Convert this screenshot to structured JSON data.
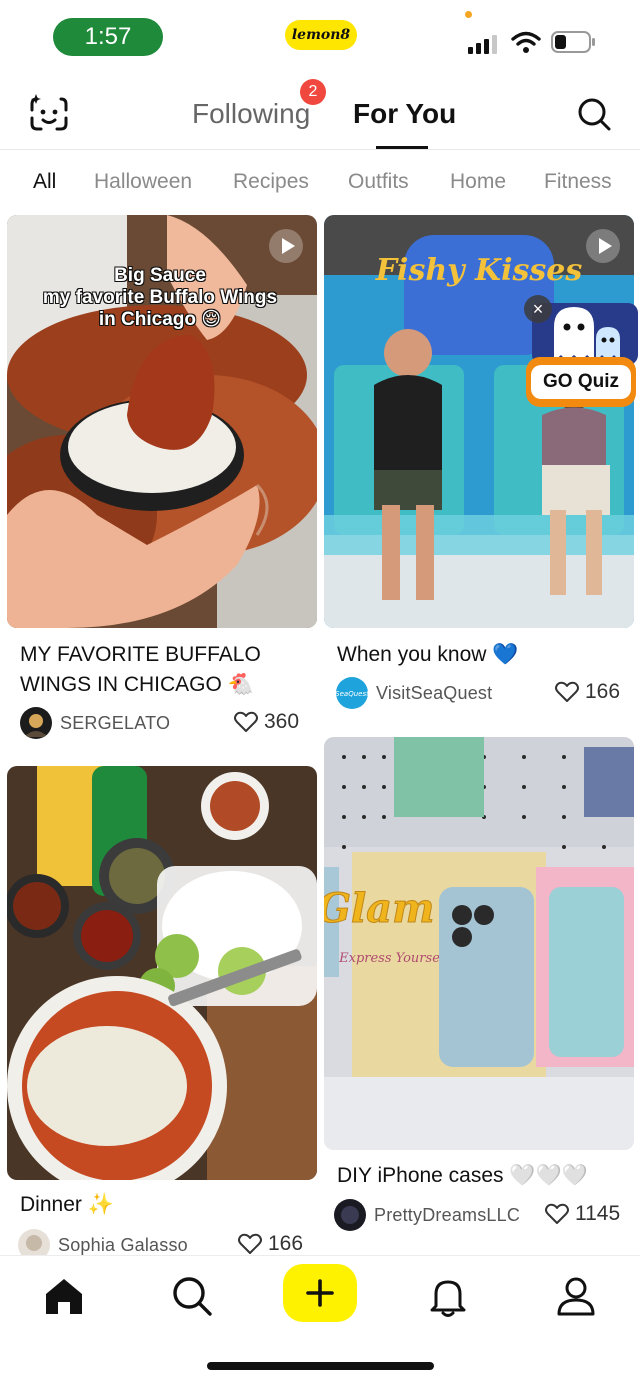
{
  "status_bar": {
    "time": "1:57",
    "brand": "lemon8"
  },
  "header": {
    "tabs": [
      {
        "label": "Following",
        "badge": "2"
      },
      {
        "label": "For You",
        "active": true
      }
    ]
  },
  "categories": [
    "All",
    "Halloween",
    "Recipes",
    "Outfits",
    "Home",
    "Fitness"
  ],
  "feed": {
    "left": [
      {
        "overlay_text": [
          "Big Sauce",
          "my favorite Buffalo Wings",
          "in Chicago 😌"
        ],
        "title_lines": [
          "MY FAVORITE BUFFALO",
          "WINGS IN CHICAGO 🐔"
        ],
        "author": "SERGELATO",
        "likes": "360"
      },
      {
        "title": "Dinner ✨",
        "author": "Sophia  Galasso",
        "likes": "166"
      }
    ],
    "right": [
      {
        "sign_text": "Fishy Kisses",
        "title": "When you know 💙",
        "author": "VisitSeaQuest",
        "avatar_text": "SeaQuest",
        "likes": "166"
      },
      {
        "box_text": "Glam Up",
        "box_sub": "Express Yourself",
        "title": "DIY iPhone cases 🤍🤍🤍",
        "author": "PrettyDreamsLLC",
        "likes": "1145"
      }
    ]
  },
  "ad": {
    "button_label": "GO Quiz",
    "close_symbol": "×"
  },
  "colors": {
    "accent_yellow": "#fff200",
    "badge_red": "#f0483e",
    "time_green": "#1f8a3a",
    "quiz_orange": "#f38a10"
  }
}
